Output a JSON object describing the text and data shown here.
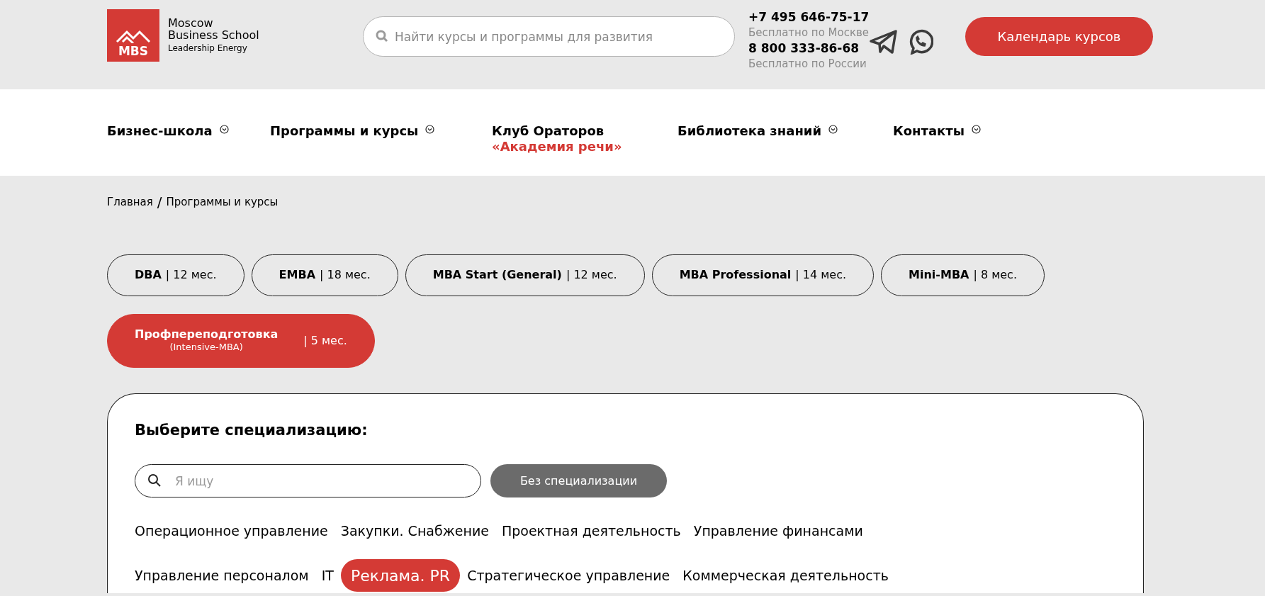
{
  "logo": {
    "line_1": "Moscow",
    "line_2": "Business School",
    "tagline": "Leadership Energy",
    "mark": "MBS"
  },
  "search": {
    "placeholder": "Найти курсы и программы для развития"
  },
  "contacts": [
    {
      "phone": "+7 495 646-75-17",
      "note": "Бесплатно по Москве"
    },
    {
      "phone": "8 800 333-86-68",
      "note": "Бесплатно по России"
    }
  ],
  "calendar_button": "Календарь курсов",
  "nav": [
    {
      "label": "Бизнес-школа",
      "has_dropdown": true
    },
    {
      "label": "Программы и курсы",
      "has_dropdown": true
    },
    {
      "label": "Клуб Ораторов",
      "accent": "«Академия речи»",
      "has_dropdown": false
    },
    {
      "label": "Библиотека знаний",
      "has_dropdown": true
    },
    {
      "label": "Контакты",
      "has_dropdown": true
    }
  ],
  "breadcrumbs": [
    "Главная",
    "Программы и курсы"
  ],
  "breadcrumb_separator": "/",
  "programs": [
    {
      "name": "DBA",
      "duration": "| 12 мес.",
      "selected": false
    },
    {
      "name": "EMBA",
      "duration": "| 18 мес.",
      "selected": false
    },
    {
      "name": "MBA Start (General)",
      "duration": "| 12 мес.",
      "selected": false
    },
    {
      "name": "MBA Professional",
      "duration": "| 14 мес.",
      "selected": false
    },
    {
      "name": "Mini-MBA",
      "duration": "| 8 мес.",
      "selected": false
    },
    {
      "name": "Профпереподготовка",
      "subtitle": "(Intensive-MBA)",
      "duration": "| 5 мес.",
      "selected": true
    }
  ],
  "specialization": {
    "title": "Выберите специализацию:",
    "search_placeholder": "Я ищу",
    "no_spec_button": "Без специализации",
    "tags": [
      {
        "label": "Операционное управление",
        "selected": false
      },
      {
        "label": "Закупки. Снабжение",
        "selected": false
      },
      {
        "label": "Проектная деятельность",
        "selected": false
      },
      {
        "label": "Управление финансами",
        "selected": false
      },
      {
        "label": "Управление персоналом",
        "selected": false
      },
      {
        "label": "IT",
        "selected": false
      },
      {
        "label": "Реклама. PR",
        "selected": true
      },
      {
        "label": "Стратегическое управление",
        "selected": false
      },
      {
        "label": "Коммерческая деятельность",
        "selected": false
      }
    ]
  }
}
